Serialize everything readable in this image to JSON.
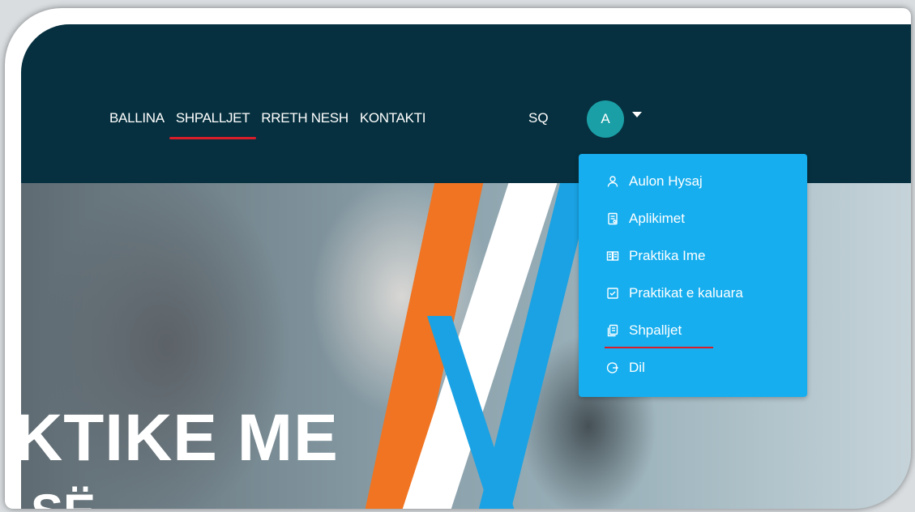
{
  "nav": {
    "items": [
      {
        "label": "BALLINA"
      },
      {
        "label": "SHPALLJET"
      },
      {
        "label": "RRETH NESH"
      },
      {
        "label": "KONTAKTI"
      }
    ],
    "lang": "SQ",
    "avatar_letter": "A"
  },
  "dropdown": {
    "items": [
      {
        "label": "Aulon Hysaj",
        "icon": "user-icon"
      },
      {
        "label": "Aplikimet",
        "icon": "document-icon"
      },
      {
        "label": "Praktika Ime",
        "icon": "book-icon"
      },
      {
        "label": "Praktikat e kaluara",
        "icon": "checkbox-icon"
      },
      {
        "label": "Shpalljet",
        "icon": "copy-icon"
      },
      {
        "label": "Dil",
        "icon": "logout-icon"
      }
    ]
  },
  "hero": {
    "line1": "KTIKE ME",
    "line2": "SË"
  },
  "colors": {
    "navbar": "#06303f",
    "dropdown": "#16aeef",
    "avatar": "#1b9fa6",
    "active_underline": "#d71d2a",
    "orange": "#f07422",
    "blue": "#1aa2e4"
  }
}
